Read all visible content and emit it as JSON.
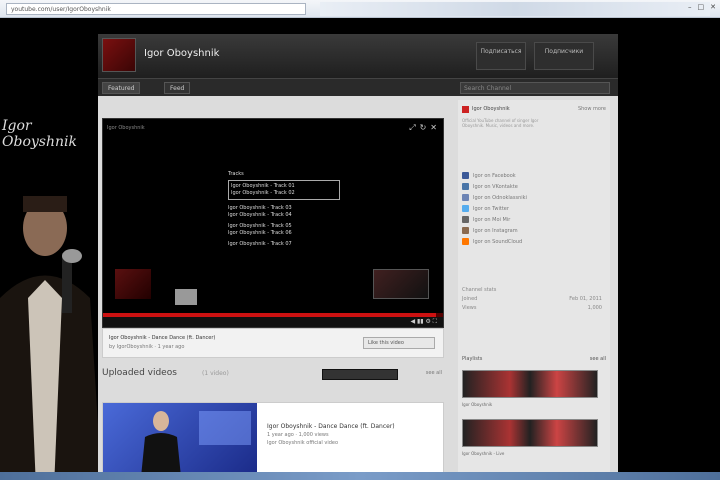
{
  "browser": {
    "url": "youtube.com/user/IgorOboyshnik",
    "tab_strip_label": "",
    "win_minimize": "–",
    "win_maximize": "□",
    "win_close": "✕"
  },
  "channel": {
    "title": "Igor Oboyshnik",
    "buttons": [
      "Подписаться",
      "Подписчики"
    ],
    "tabs": [
      "Featured",
      "Feed"
    ],
    "search_placeholder": "Search Channel"
  },
  "art": {
    "signature": "Igor Oboyshnik"
  },
  "player": {
    "top_label": "Igor Oboyshnik",
    "tracklist_title": "Tracks",
    "tracks": [
      "Igor Oboyshnik - Track 01",
      "Igor Oboyshnik - Track 02",
      "Igor Oboyshnik - Track 03",
      "Igor Oboyshnik - Track 04",
      "Igor Oboyshnik - Track 05",
      "Igor Oboyshnik - Track 06",
      "Igor Oboyshnik - Track 07"
    ],
    "progress": 0.98,
    "controls_right": "◀ ▮▮ ⚙ ⛶",
    "top_icons": [
      "⤢",
      "↻",
      "✕"
    ]
  },
  "video": {
    "title": "Igor Oboyshnik - Dance Dance (ft. Dancer)",
    "sub": "by IgorOboyshnik · 1 year ago",
    "action": "Like this video"
  },
  "uploads": {
    "title": "Uploaded videos",
    "count": "(1 video)",
    "more": "see all"
  },
  "featured": {
    "title": "Igor Oboyshnik - Dance Dance (ft. Dancer)",
    "meta": "1 year ago · 1,000 views",
    "desc": "Igor Oboyshnik official video"
  },
  "sidebar": {
    "name": "Igor Oboyshnik",
    "more": "Show more",
    "desc": "Official YouTube channel of singer Igor Oboyshnik. Music, videos and more.",
    "links": [
      {
        "text": "Igor on Facebook",
        "color": "#3b5998",
        "icon": "facebook-icon"
      },
      {
        "text": "Igor on VKontakte",
        "color": "#4a76a8",
        "icon": "vk-icon"
      },
      {
        "text": "Igor on Odnoklassniki",
        "color": "#6d84b4",
        "icon": "ok-icon"
      },
      {
        "text": "Igor on Twitter",
        "color": "#55acee",
        "icon": "twitter-icon"
      },
      {
        "text": "Igor on Moi Mir",
        "color": "#666666",
        "icon": "mymir-icon"
      },
      {
        "text": "Igor on Instagram",
        "color": "#8a6a4f",
        "icon": "instagram-icon"
      },
      {
        "text": "Igor on SoundCloud",
        "color": "#ff7700",
        "icon": "soundcloud-icon"
      }
    ],
    "stats_title": "Channel stats",
    "stats": [
      {
        "label": "Joined",
        "value": "Feb 01, 2011"
      },
      {
        "label": "Views",
        "value": "1,000"
      }
    ],
    "playlists_title": "Playlists",
    "playlists_more": "see all",
    "playlist_labels": [
      "Igor Oboyshnik",
      "Igor Oboyshnik - Live"
    ]
  }
}
